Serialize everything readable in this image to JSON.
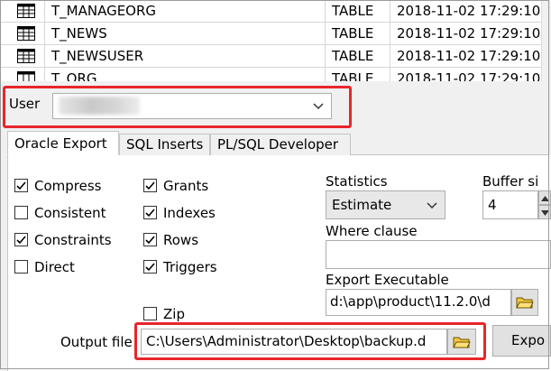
{
  "tables": {
    "rows": [
      {
        "name": "T_MANAGEORG",
        "type": "TABLE",
        "date": "2018-11-02 17:29:10"
      },
      {
        "name": "T_NEWS",
        "type": "TABLE",
        "date": "2018-11-02 17:29:10"
      },
      {
        "name": "T_NEWSUSER",
        "type": "TABLE",
        "date": "2018-11-02 17:29:10"
      },
      {
        "name": "T_ORG",
        "type": "TABLE",
        "date": "2018-11-02 17:29:10"
      }
    ],
    "icon": "table-grid-icon"
  },
  "user": {
    "label": "User",
    "value": ""
  },
  "tabs": [
    {
      "label": "Oracle Export",
      "active": true
    },
    {
      "label": "SQL Inserts",
      "active": false
    },
    {
      "label": "PL/SQL Developer",
      "active": false
    }
  ],
  "options": {
    "compress": {
      "label": "Compress",
      "checked": true
    },
    "consistent": {
      "label": "Consistent",
      "checked": false
    },
    "constraints": {
      "label": "Constraints",
      "checked": true
    },
    "direct": {
      "label": "Direct",
      "checked": false
    },
    "grants": {
      "label": "Grants",
      "checked": true
    },
    "indexes": {
      "label": "Indexes",
      "checked": true
    },
    "rows": {
      "label": "Rows",
      "checked": true
    },
    "triggers": {
      "label": "Triggers",
      "checked": true
    },
    "zip": {
      "label": "Zip",
      "checked": false
    }
  },
  "statistics": {
    "label": "Statistics",
    "value": "Estimate"
  },
  "buffer": {
    "label": "Buffer si",
    "value": "4"
  },
  "where": {
    "label": "Where clause",
    "value": ""
  },
  "export_exe": {
    "label": "Export Executable",
    "value": "d:\\app\\product\\11.2.0\\d"
  },
  "output_file": {
    "label": "Output file",
    "value": "C:\\Users\\Administrator\\Desktop\\backup.d"
  },
  "export_button": {
    "label": "Expo"
  },
  "colors": {
    "highlight": "#e8262b",
    "panel": "#f0f0f0",
    "border": "#adadad"
  }
}
